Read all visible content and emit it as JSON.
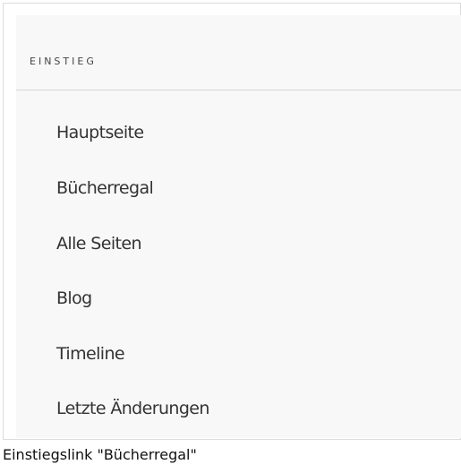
{
  "section": {
    "title": "EINSTIEG"
  },
  "nav": {
    "items": [
      {
        "label": "Hauptseite"
      },
      {
        "label": "Bücherregal"
      },
      {
        "label": "Alle Seiten"
      },
      {
        "label": "Blog"
      },
      {
        "label": "Timeline"
      },
      {
        "label": "Letzte Änderungen"
      }
    ]
  },
  "caption": "Einstiegslink \"Bücherregal\""
}
